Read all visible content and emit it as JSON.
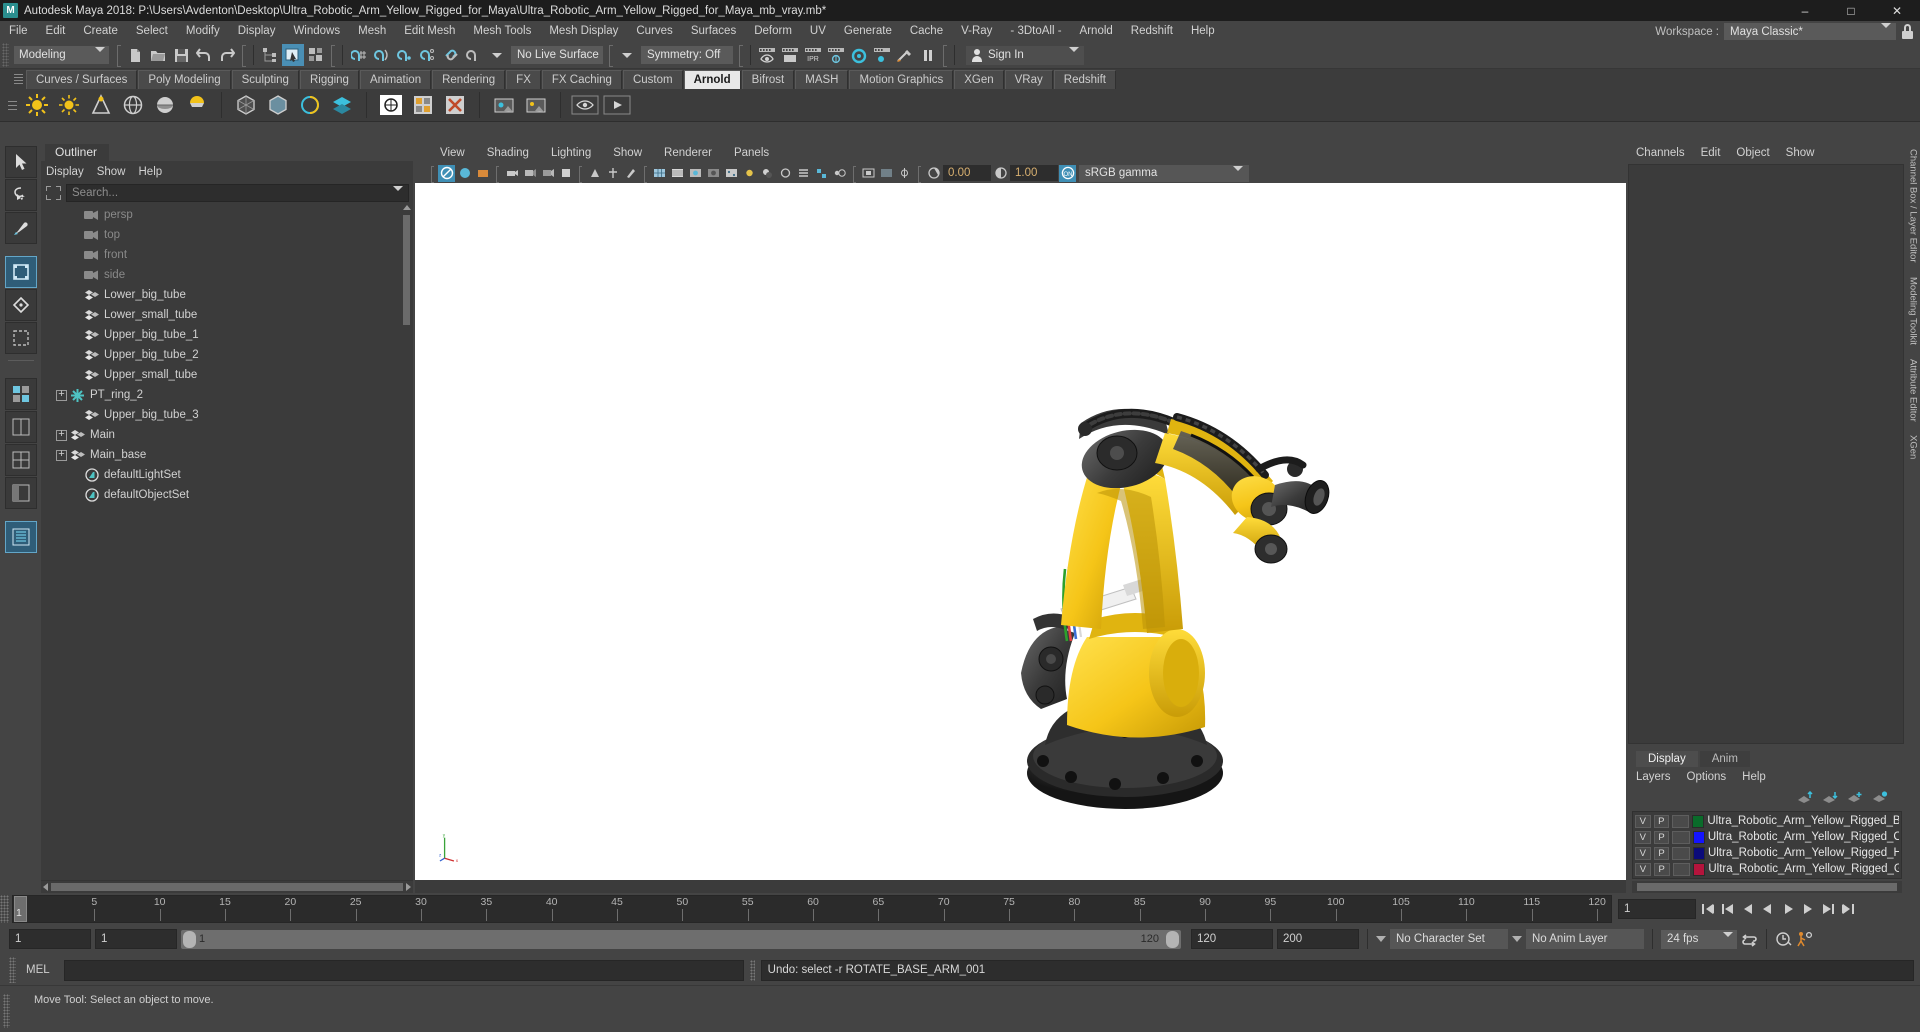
{
  "window": {
    "title": "Autodesk Maya 2018: P:\\Users\\Avdenton\\Desktop\\Ultra_Robotic_Arm_Yellow_Rigged_for_Maya\\Ultra_Robotic_Arm_Yellow_Rigged_for_Maya_mb_vray.mb*",
    "logo_letter": "M",
    "minimize": "–",
    "maximize": "□",
    "close": "✕"
  },
  "menubar": {
    "items": [
      "File",
      "Edit",
      "Create",
      "Select",
      "Modify",
      "Display",
      "Windows",
      "Mesh",
      "Edit Mesh",
      "Mesh Tools",
      "Mesh Display",
      "Curves",
      "Surfaces",
      "Deform",
      "UV",
      "Generate",
      "Cache",
      "V-Ray",
      "- 3DtoAll -",
      "Arnold",
      "Redshift",
      "Help"
    ],
    "workspace_label": "Workspace :",
    "workspace_value": "Maya Classic*"
  },
  "statusline": {
    "mode": "Modeling",
    "live_surface": "No Live Surface",
    "symmetry": "Symmetry: Off",
    "signin": "Sign In"
  },
  "shelf": {
    "tabs": [
      "Curves / Surfaces",
      "Poly Modeling",
      "Sculpting",
      "Rigging",
      "Animation",
      "Rendering",
      "FX",
      "FX Caching",
      "Custom",
      "Arnold",
      "Bifrost",
      "MASH",
      "Motion Graphics",
      "XGen",
      "VRay",
      "Redshift"
    ],
    "active_tab": "Arnold"
  },
  "outliner": {
    "tab": "Outliner",
    "menu": [
      "Display",
      "Show",
      "Help"
    ],
    "search_placeholder": "Search...",
    "items": [
      {
        "label": "persp",
        "icon": "camera-icon",
        "dim": true,
        "expandable": false,
        "indent": 1
      },
      {
        "label": "top",
        "icon": "camera-icon",
        "dim": true,
        "expandable": false,
        "indent": 1
      },
      {
        "label": "front",
        "icon": "camera-icon",
        "dim": true,
        "expandable": false,
        "indent": 1
      },
      {
        "label": "side",
        "icon": "camera-icon",
        "dim": true,
        "expandable": false,
        "indent": 1
      },
      {
        "label": "Lower_big_tube",
        "icon": "transform-icon",
        "dim": false,
        "expandable": false,
        "indent": 1
      },
      {
        "label": "Lower_small_tube",
        "icon": "transform-icon",
        "dim": false,
        "expandable": false,
        "indent": 1
      },
      {
        "label": "Upper_big_tube_1",
        "icon": "transform-icon",
        "dim": false,
        "expandable": false,
        "indent": 1
      },
      {
        "label": "Upper_big_tube_2",
        "icon": "transform-icon",
        "dim": false,
        "expandable": false,
        "indent": 1
      },
      {
        "label": "Upper_small_tube",
        "icon": "transform-icon",
        "dim": false,
        "expandable": false,
        "indent": 1
      },
      {
        "label": "PT_ring_2",
        "icon": "joint-icon",
        "dim": false,
        "expandable": true,
        "indent": 0
      },
      {
        "label": "Upper_big_tube_3",
        "icon": "transform-icon",
        "dim": false,
        "expandable": false,
        "indent": 1
      },
      {
        "label": "Main",
        "icon": "transform-icon",
        "dim": false,
        "expandable": true,
        "indent": 0
      },
      {
        "label": "Main_base",
        "icon": "transform-icon",
        "dim": false,
        "expandable": true,
        "indent": 0
      },
      {
        "label": "defaultLightSet",
        "icon": "set-icon",
        "dim": false,
        "expandable": false,
        "indent": 1
      },
      {
        "label": "defaultObjectSet",
        "icon": "set-icon",
        "dim": false,
        "expandable": false,
        "indent": 1
      }
    ]
  },
  "viewport": {
    "menu": [
      "View",
      "Shading",
      "Lighting",
      "Show",
      "Renderer",
      "Panels"
    ],
    "exposure": "0.00",
    "gamma": "1.00",
    "color_space": "sRGB gamma"
  },
  "channelbox": {
    "menu": [
      "Channels",
      "Edit",
      "Object",
      "Show"
    ]
  },
  "layer_editor": {
    "tabs": [
      "Display",
      "Anim"
    ],
    "active_tab": "Display",
    "menu": [
      "Layers",
      "Options",
      "Help"
    ],
    "col_v": "V",
    "col_p": "P",
    "layers": [
      {
        "name": "Ultra_Robotic_Arm_Yellow_Rigged_Bone",
        "color": "#0a6b2a",
        "visible": "V",
        "playback": "P"
      },
      {
        "name": "Ultra_Robotic_Arm_Yellow_Rigged_Conf",
        "color": "#1414ff",
        "visible": "V",
        "playback": "P"
      },
      {
        "name": "Ultra_Robotic_Arm_Yellow_Rigged_Help",
        "color": "#0b0b7a",
        "visible": "V",
        "playback": "P"
      },
      {
        "name": "Ultra_Robotic_Arm_Yellow_Rigged_Geo",
        "color": "#b5143c",
        "visible": "V",
        "playback": "P"
      }
    ]
  },
  "right_tabs": [
    "Channel Box / Layer Editor",
    "Modeling Toolkit",
    "Attribute Editor",
    "XGen"
  ],
  "timeslider": {
    "current_frame": "1",
    "tick_labels": [
      "5",
      "10",
      "15",
      "20",
      "25",
      "30",
      "35",
      "40",
      "45",
      "50",
      "55",
      "60",
      "65",
      "70",
      "75",
      "80",
      "85",
      "90",
      "95",
      "100",
      "105",
      "110",
      "115",
      "120"
    ],
    "key_field": "1"
  },
  "range": {
    "anim_start": "1",
    "range_start": "1",
    "bar_start_label": "1",
    "bar_end_label": "120",
    "range_end": "120",
    "anim_end": "200",
    "character_set": "No Character Set",
    "anim_layer": "No Anim Layer",
    "fps": "24 fps"
  },
  "command_line": {
    "language": "MEL",
    "input_value": "",
    "feedback": "Undo: select -r ROTATE_BASE_ARM_001"
  },
  "statusbar": {
    "help_text": "Move Tool: Select an object to move."
  },
  "colors": {
    "accent": "#4a8fb5",
    "panel_bg": "#444444",
    "dark_bg": "#2d2d2d",
    "viewport_bg": "#ffffff"
  }
}
